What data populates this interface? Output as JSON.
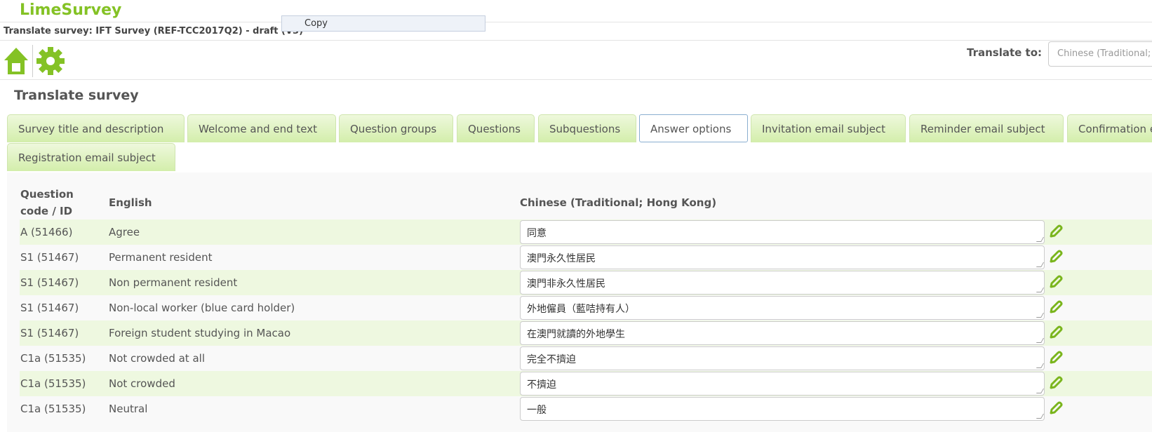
{
  "app": {
    "logo": "LimeSurvey",
    "title": "Translate survey: IFT Survey (REF-TCC2017Q2) - draft (V3)"
  },
  "context_menu": {
    "copy": "Copy"
  },
  "toolbar": {
    "translate_to_label": "Translate to:",
    "translate_to_value": "Chinese (Traditional; Hong Kong)"
  },
  "heading": "Translate survey",
  "tabs": [
    {
      "label": "Survey title and description"
    },
    {
      "label": "Welcome and end text"
    },
    {
      "label": "Question groups"
    },
    {
      "label": "Questions"
    },
    {
      "label": "Subquestions"
    },
    {
      "label": "Answer options",
      "active": true
    },
    {
      "label": "Invitation email subject"
    },
    {
      "label": "Reminder email subject"
    },
    {
      "label": "Confirmation email subject"
    },
    {
      "label": "Registration email subject"
    }
  ],
  "table": {
    "headers": {
      "code": "Question code / ID",
      "source": "English",
      "target": "Chinese (Traditional; Hong Kong)"
    },
    "rows": [
      {
        "code": "A (51466)",
        "english": "Agree",
        "translation": "同意"
      },
      {
        "code": "S1 (51467)",
        "english": "Permanent resident",
        "translation": "澳門永久性居民"
      },
      {
        "code": "S1 (51467)",
        "english": "Non permanent resident",
        "translation": "澳門非永久性居民"
      },
      {
        "code": "S1 (51467)",
        "english": "Non-local worker (blue card holder)",
        "translation": "外地僱員（藍咭持有人）"
      },
      {
        "code": "S1 (51467)",
        "english": "Foreign student studying in Macao",
        "translation": "在澳門就讀的外地學生"
      },
      {
        "code": "C1a (51535)",
        "english": "Not crowded at all",
        "translation": "完全不擠迫"
      },
      {
        "code": "C1a (51535)",
        "english": "Not crowded",
        "translation": "不擠迫"
      },
      {
        "code": "C1a (51535)",
        "english": "Neutral",
        "translation": "一般"
      }
    ]
  },
  "colors": {
    "brand": "#84c225",
    "row_alt": "#eef8e0"
  }
}
